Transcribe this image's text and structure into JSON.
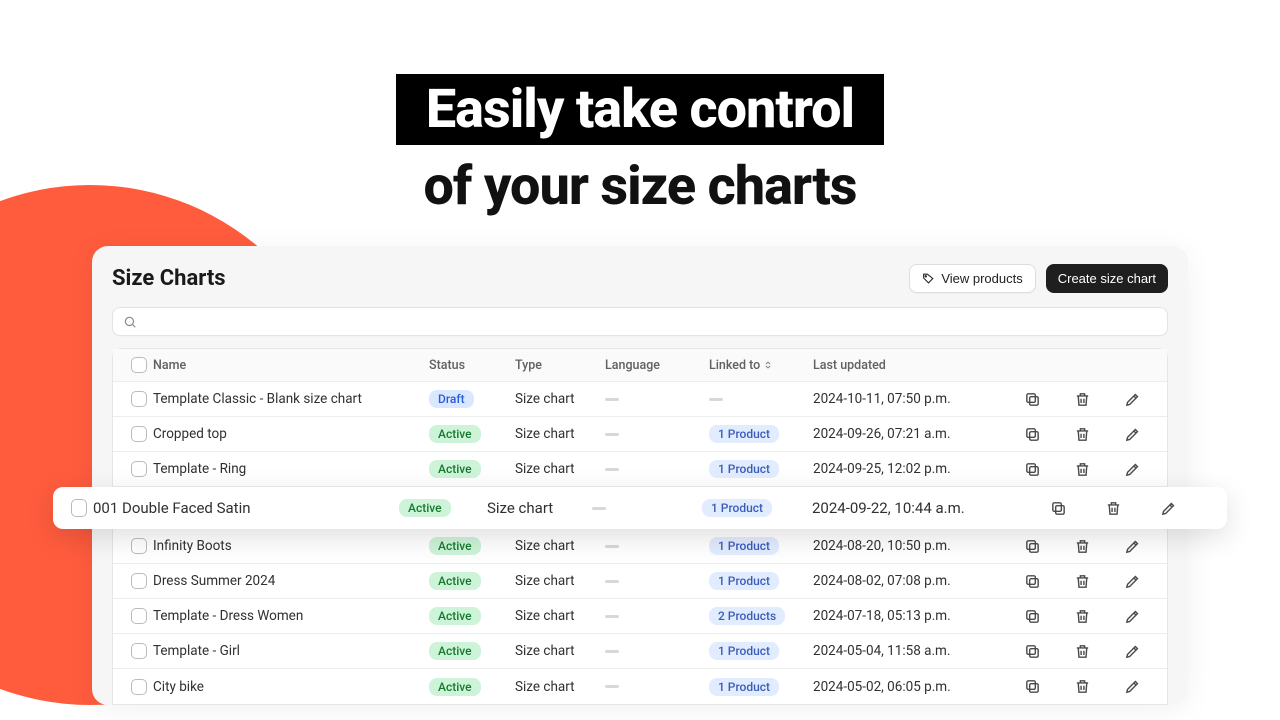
{
  "hero": {
    "line1": "Easily take control",
    "line2": "of your size charts"
  },
  "panel": {
    "title": "Size Charts",
    "view_products_label": "View products",
    "create_label": "Create size chart",
    "search_placeholder": ""
  },
  "columns": {
    "name": "Name",
    "status": "Status",
    "type": "Type",
    "language": "Language",
    "linked_to": "Linked to",
    "last_updated": "Last updated"
  },
  "rows": [
    {
      "name": "Template Classic - Blank size chart",
      "status": "Draft",
      "type": "Size chart",
      "linked": "",
      "updated": "2024-10-11, 07:50 p.m.",
      "highlight": false
    },
    {
      "name": "Cropped top",
      "status": "Active",
      "type": "Size chart",
      "linked": "1 Product",
      "updated": "2024-09-26, 07:21 a.m.",
      "highlight": false
    },
    {
      "name": "Template - Ring",
      "status": "Active",
      "type": "Size chart",
      "linked": "1 Product",
      "updated": "2024-09-25, 12:02 p.m.",
      "highlight": false
    },
    {
      "name": "001 Double Faced Satin",
      "status": "Active",
      "type": "Size chart",
      "linked": "1 Product",
      "updated": "2024-09-22, 10:44 a.m.",
      "highlight": true
    },
    {
      "name": "Infinity Boots",
      "status": "Active",
      "type": "Size chart",
      "linked": "1 Product",
      "updated": "2024-08-20, 10:50 p.m.",
      "highlight": false
    },
    {
      "name": "Dress Summer 2024",
      "status": "Active",
      "type": "Size chart",
      "linked": "1 Product",
      "updated": "2024-08-02, 07:08 p.m.",
      "highlight": false
    },
    {
      "name": "Template - Dress Women",
      "status": "Active",
      "type": "Size chart",
      "linked": "2 Products",
      "updated": "2024-07-18, 05:13 p.m.",
      "highlight": false
    },
    {
      "name": "Template - Girl",
      "status": "Active",
      "type": "Size chart",
      "linked": "1 Product",
      "updated": "2024-05-04, 11:58 a.m.",
      "highlight": false
    },
    {
      "name": "City bike",
      "status": "Active",
      "type": "Size chart",
      "linked": "1 Product",
      "updated": "2024-05-02, 06:05 p.m.",
      "highlight": false
    }
  ]
}
